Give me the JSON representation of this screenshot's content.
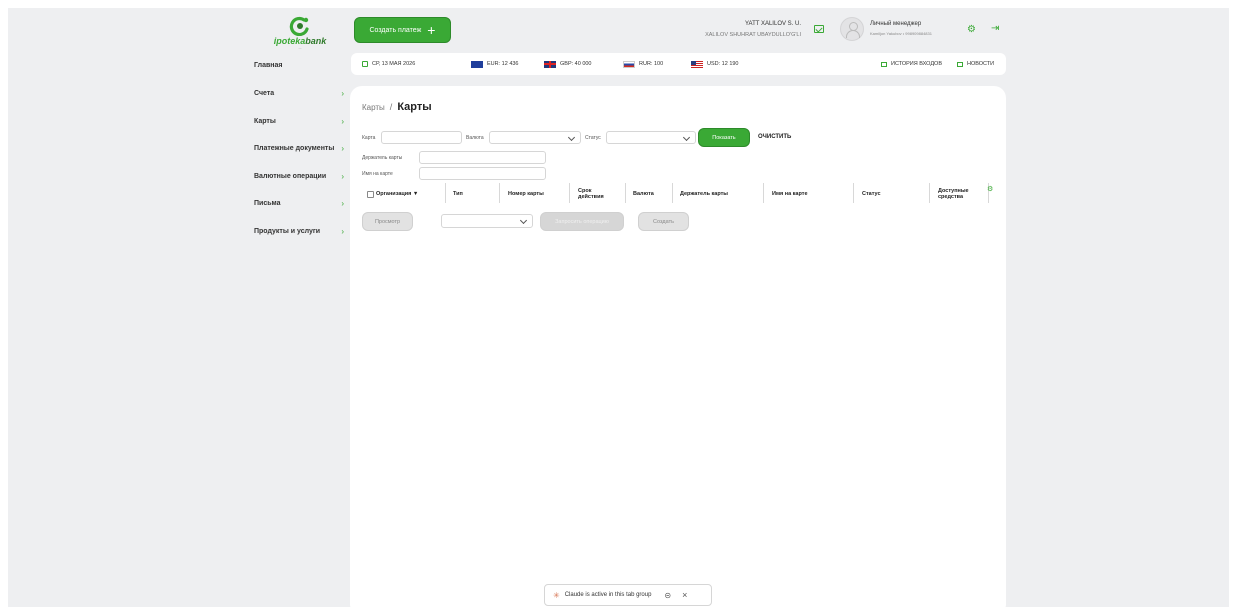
{
  "logo": {
    "brand_light": "ipoteka",
    "brand_dark": "bank",
    "sub": "—"
  },
  "header": {
    "create_payment": "Создать платеж",
    "user_name": "YATT XALILOV S. U.",
    "user_org": "XALILOV SHUHRAT UBAYDULLO'G'LI",
    "manager_title": "Личный менеджер",
    "manager_contact": "Kamiljon Yakubov • 998909884831"
  },
  "rates": {
    "date": "СР, 13 МАЯ 2026",
    "eur": "EUR:  12 436",
    "gbp": "GBP:  40 000",
    "rur": "RUR:  100",
    "usd": "USD:  12 190",
    "history": "ИСТОРИЯ ВХОДОВ",
    "news": "НОВОСТИ"
  },
  "sidebar": {
    "items": [
      {
        "label": "Главная",
        "chevron": ""
      },
      {
        "label": "Счета",
        "chevron": "›"
      },
      {
        "label": "Карты",
        "chevron": "›"
      },
      {
        "label": "Платежные документы",
        "chevron": "›"
      },
      {
        "label": "Валютные операции",
        "chevron": "›"
      },
      {
        "label": "Письма",
        "chevron": "›"
      },
      {
        "label": "Продукты и услуги",
        "chevron": "›"
      }
    ]
  },
  "breadcrumb": {
    "parent": "Карты",
    "separator": "/",
    "current": "Карты"
  },
  "filters": {
    "card_label": "Карта",
    "currency_label": "Валюта",
    "status_label": "Статус",
    "holder_label": "Держатель карты",
    "name_on_card_label": "Имя на карте",
    "show_button": "Показать",
    "clear_button": "ОЧИСТИТЬ"
  },
  "table": {
    "columns": [
      "Организация ▼",
      "Тип",
      "Номер карты",
      "Срок действия",
      "Валюта",
      "Держатель карты",
      "Имя на карте",
      "Статус",
      "Доступные средства"
    ]
  },
  "actions": {
    "view": "Просмотр",
    "request_operation": "Запросить операцию",
    "create": "Создать"
  },
  "claude_bar": {
    "text": "Claude is active in this tab group"
  },
  "colors": {
    "accent": "#3aa935",
    "background": "#eeeff1",
    "panel": "#ffffff"
  }
}
